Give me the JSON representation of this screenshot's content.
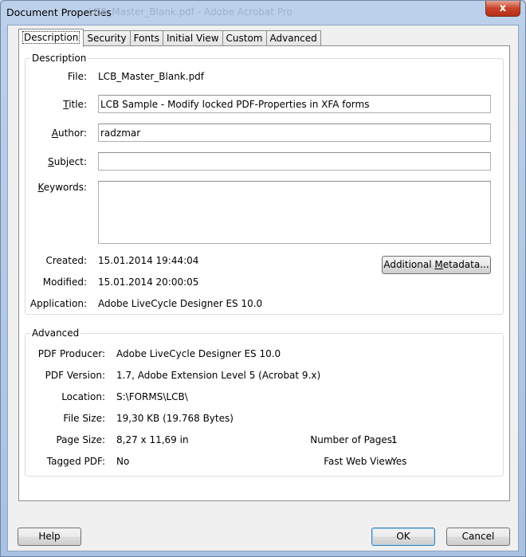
{
  "window": {
    "title": "Document Properties",
    "ghost_title": "LCB_Master_Blank.pdf - Adobe Acrobat Pro",
    "close_glyph": "x"
  },
  "tabs": [
    {
      "label": "Description",
      "active": true
    },
    {
      "label": "Security"
    },
    {
      "label": "Fonts"
    },
    {
      "label": "Initial View"
    },
    {
      "label": "Custom"
    },
    {
      "label": "Advanced"
    }
  ],
  "description": {
    "group_title": "Description",
    "file_label": "File:",
    "file_value": "LCB_Master_Blank.pdf",
    "title_label_pre": "",
    "title_label_u": "T",
    "title_label_post": "itle:",
    "title_value": "LCB Sample - Modify locked PDF-Properties in XFA forms",
    "author_label_u": "A",
    "author_label_post": "uthor:",
    "author_value": "radzmar",
    "subject_label_u": "S",
    "subject_label_post": "ubject:",
    "subject_value": "",
    "keywords_label_u": "K",
    "keywords_label_post": "eywords:",
    "keywords_value": "",
    "created_label": "Created:",
    "created_value": "15.01.2014 19:44:04",
    "modified_label": "Modified:",
    "modified_value": "15.01.2014 20:00:05",
    "application_label": "Application:",
    "application_value": "Adobe LiveCycle Designer ES 10.0",
    "metadata_button_pre": "Additional ",
    "metadata_button_u": "M",
    "metadata_button_post": "etadata..."
  },
  "advanced": {
    "group_title": "Advanced",
    "pdf_producer_label": "PDF Producer:",
    "pdf_producer_value": "Adobe LiveCycle Designer ES 10.0",
    "pdf_version_label": "PDF Version:",
    "pdf_version_value": "1.7, Adobe Extension Level 5 (Acrobat 9.x)",
    "location_label": "Location:",
    "location_value": "S:\\FORMS\\LCB\\",
    "file_size_label": "File Size:",
    "file_size_value": "19,30 KB (19.768 Bytes)",
    "page_size_label": "Page Size:",
    "page_size_value": "8,27 x 11,69 in",
    "num_pages_label": "Number of Pages:",
    "num_pages_value": "1",
    "tagged_pdf_label": "Tagged PDF:",
    "tagged_pdf_value": "No",
    "fast_web_label": "Fast Web View:",
    "fast_web_value": "Yes"
  },
  "buttons": {
    "help": "Help",
    "ok": "OK",
    "cancel": "Cancel"
  }
}
